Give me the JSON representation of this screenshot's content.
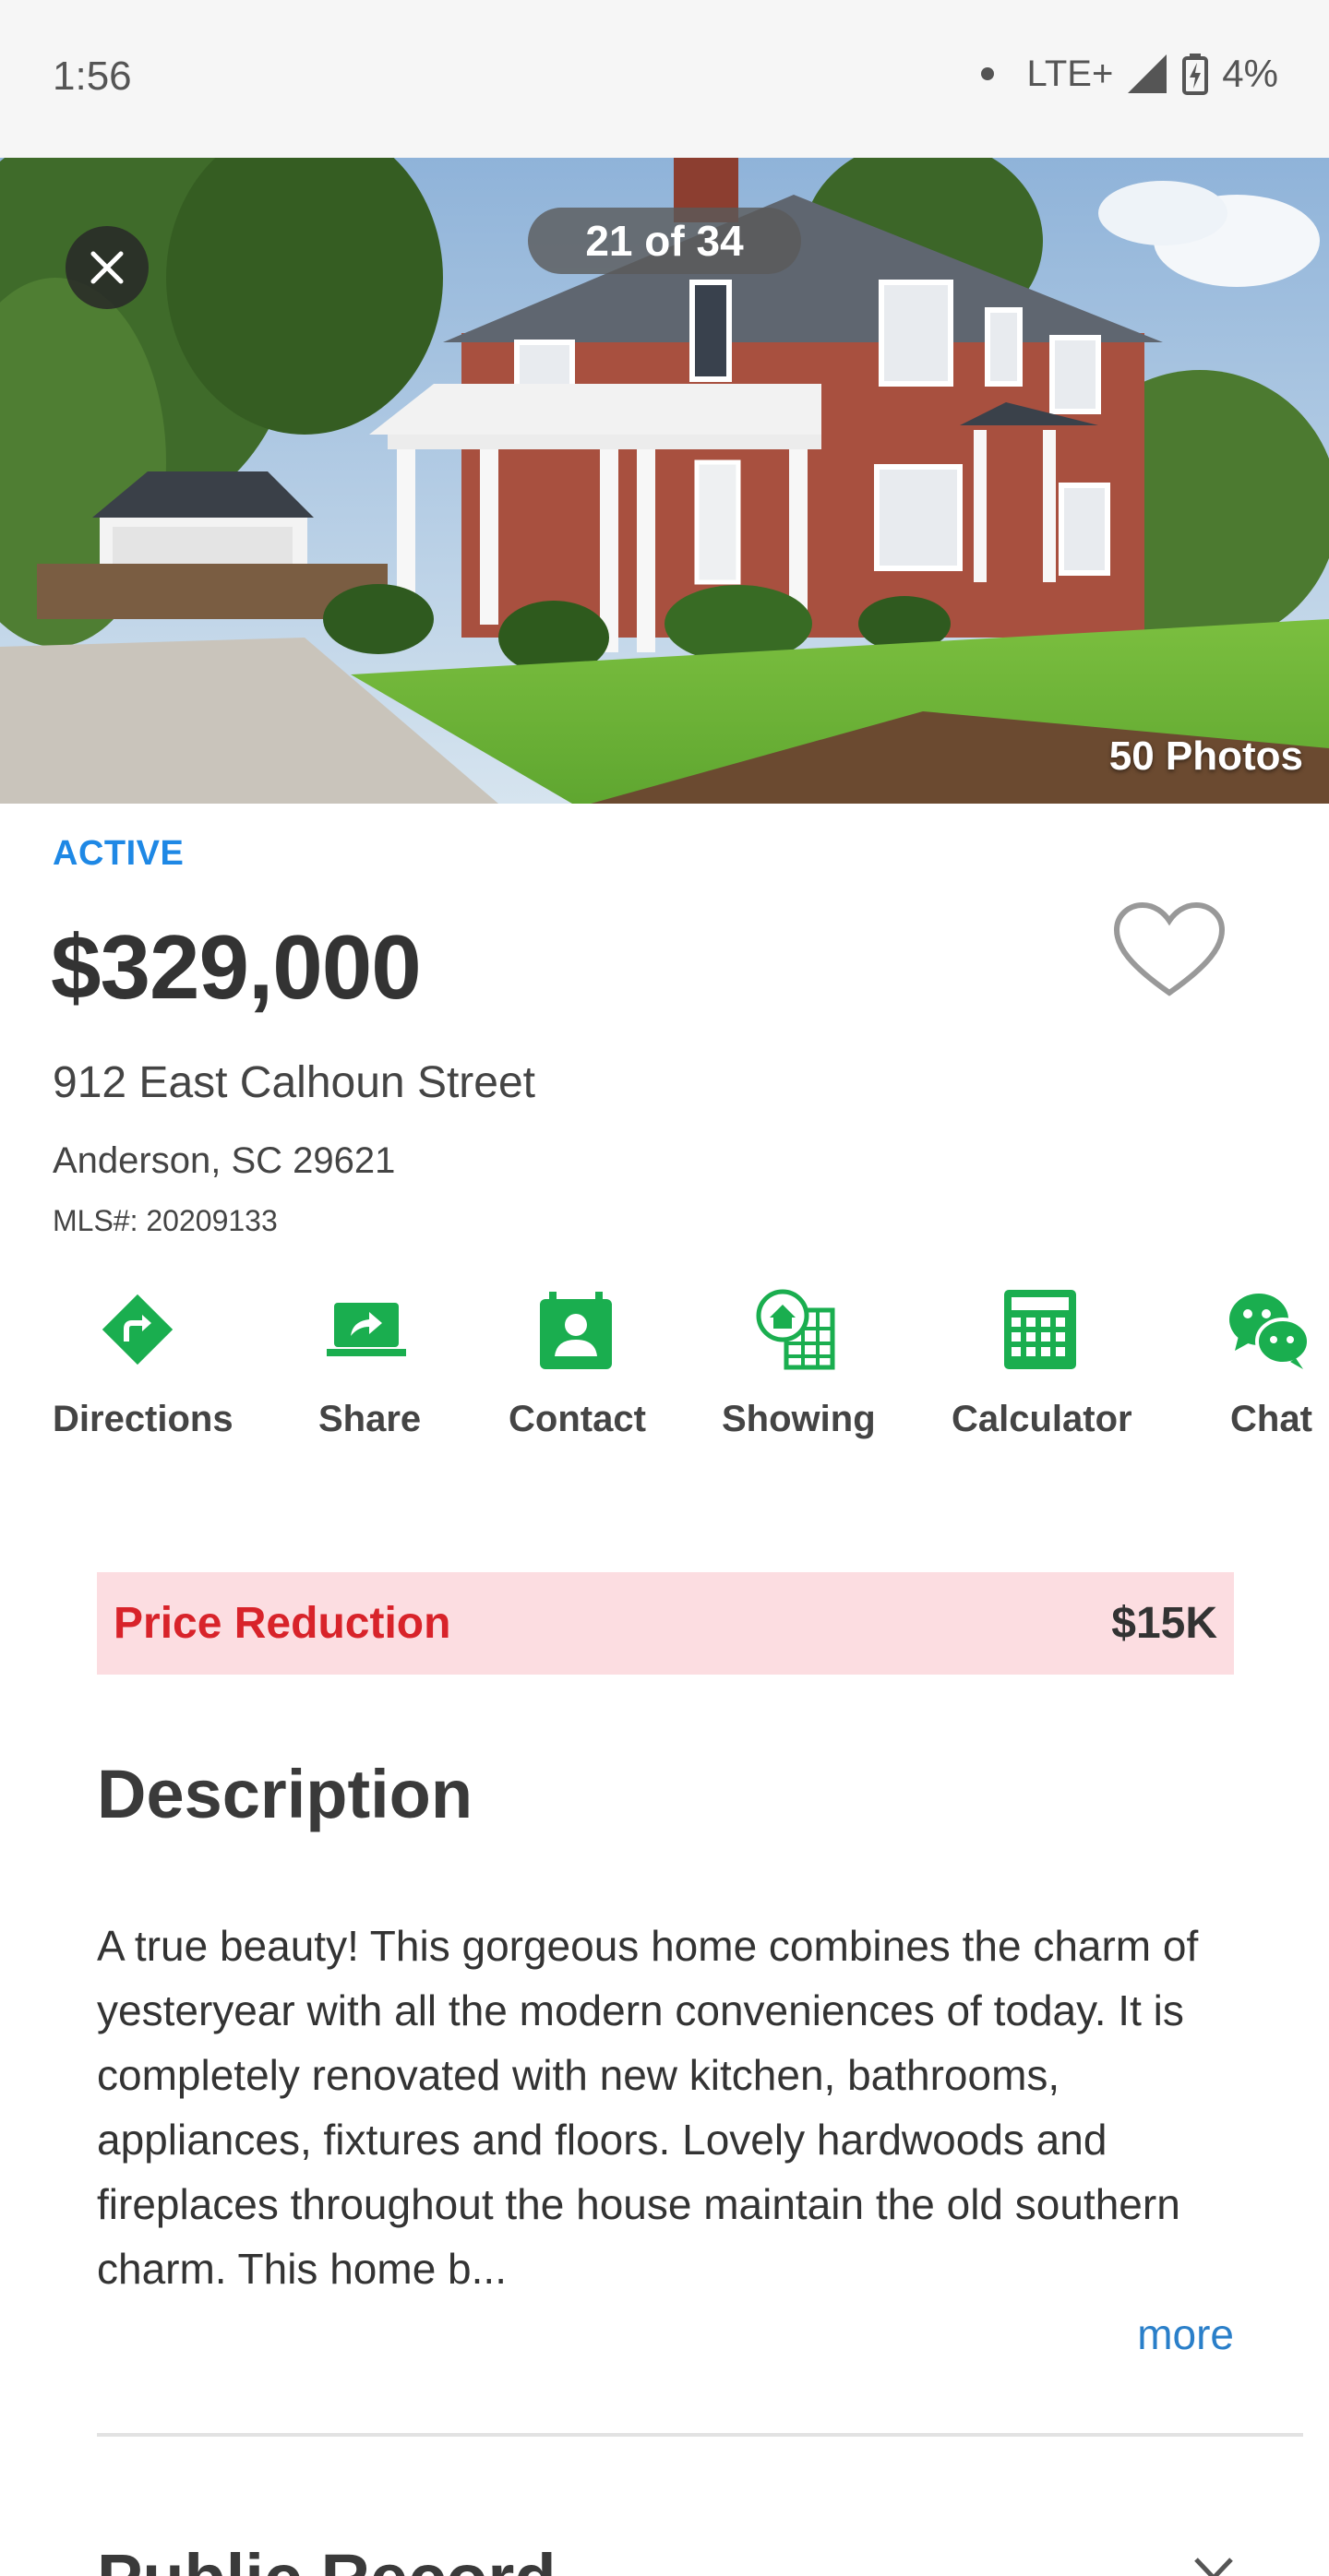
{
  "status_bar": {
    "time": "1:56",
    "network": "LTE+",
    "battery": "4%"
  },
  "gallery": {
    "counter": "21 of 34",
    "photos_label": "50 Photos"
  },
  "listing": {
    "status": "ACTIVE",
    "price": "$329,000",
    "address": "912 East Calhoun Street",
    "city_state_zip": "Anderson, SC 29621",
    "mls": "MLS#: 20209133"
  },
  "actions": [
    {
      "label": "Directions",
      "icon": "directions-icon"
    },
    {
      "label": "Share",
      "icon": "share-icon"
    },
    {
      "label": "Contact",
      "icon": "contact-icon"
    },
    {
      "label": "Showing",
      "icon": "showing-icon"
    },
    {
      "label": "Calculator",
      "icon": "calculator-icon"
    },
    {
      "label": "Chat",
      "icon": "chat-icon"
    }
  ],
  "price_reduction": {
    "label": "Price Reduction",
    "value": "$15K"
  },
  "description": {
    "title": "Description",
    "text": "A true beauty! This gorgeous home combines the charm of yesteryear with all the modern conveniences of today. It is completely renovated with new kitchen, bathrooms, appliances, fixtures and floors. Lovely hardwoods and fireplaces throughout the house maintain the old southern charm. This home b...",
    "more_label": "more"
  },
  "next_section": {
    "title": "Public Record"
  },
  "colors": {
    "accent_green": "#1aae4f",
    "status_blue": "#1e88e5",
    "reduction_bg": "#fcdde1",
    "reduction_red": "#d8232a",
    "link_blue": "#2a7fc9"
  }
}
